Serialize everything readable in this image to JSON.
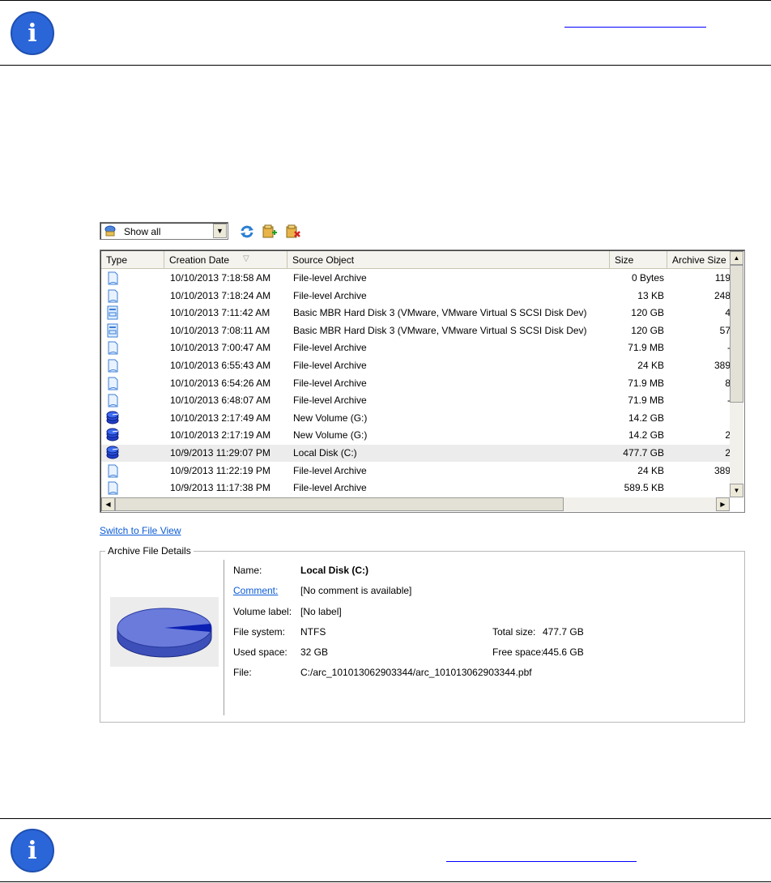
{
  "toolbar": {
    "filter_selected": "Show all",
    "buttons": [
      "refresh-icon",
      "add-archive-icon",
      "delete-archive-icon"
    ]
  },
  "grid": {
    "columns": [
      "Type",
      "Creation Date",
      "Source Object",
      "Size",
      "Archive Size"
    ],
    "rows": [
      {
        "type": "file-archive-icon",
        "date": "10/10/2013 7:18:58 AM",
        "source": "File-level Archive",
        "size": "0 Bytes",
        "archive": "119"
      },
      {
        "type": "file-archive-icon",
        "date": "10/10/2013 7:18:24 AM",
        "source": "File-level Archive",
        "size": "13 KB",
        "archive": "248"
      },
      {
        "type": "disk-archive-icon",
        "date": "10/10/2013 7:11:42 AM",
        "source": "Basic MBR Hard Disk 3 (VMware, VMware Virtual S SCSI Disk Dev)",
        "size": "120 GB",
        "archive": "4"
      },
      {
        "type": "disk-archive-icon",
        "date": "10/10/2013 7:08:11 AM",
        "source": "Basic MBR Hard Disk 3 (VMware, VMware Virtual S SCSI Disk Dev)",
        "size": "120 GB",
        "archive": "57"
      },
      {
        "type": "file-archive-icon",
        "date": "10/10/2013 7:00:47 AM",
        "source": "File-level Archive",
        "size": "71.9 MB",
        "archive": "-"
      },
      {
        "type": "file-archive-icon",
        "date": "10/10/2013 6:55:43 AM",
        "source": "File-level Archive",
        "size": "24 KB",
        "archive": "389"
      },
      {
        "type": "file-archive-icon",
        "date": "10/10/2013 6:54:26 AM",
        "source": "File-level Archive",
        "size": "71.9 MB",
        "archive": "8"
      },
      {
        "type": "file-archive-icon",
        "date": "10/10/2013 6:48:07 AM",
        "source": "File-level Archive",
        "size": "71.9 MB",
        "archive": "-"
      },
      {
        "type": "volume-archive-icon",
        "date": "10/10/2013 2:17:49 AM",
        "source": "New Volume (G:)",
        "size": "14.2 GB",
        "archive": ""
      },
      {
        "type": "volume-archive-icon",
        "date": "10/10/2013 2:17:19 AM",
        "source": "New Volume (G:)",
        "size": "14.2 GB",
        "archive": "2"
      },
      {
        "type": "volume-archive-icon",
        "date": "10/9/2013 11:29:07 PM",
        "source": "Local Disk (C:)",
        "size": "477.7 GB",
        "archive": "2",
        "selected": true
      },
      {
        "type": "file-archive-icon",
        "date": "10/9/2013 11:22:19 PM",
        "source": "File-level Archive",
        "size": "24 KB",
        "archive": "389"
      },
      {
        "type": "file-archive-icon",
        "date": "10/9/2013 11:17:38 PM",
        "source": "File-level Archive",
        "size": "589.5 KB",
        "archive": ""
      }
    ]
  },
  "switch_view_link": "Switch to File View",
  "details": {
    "legend": "Archive File Details",
    "name_label": "Name:",
    "name_value": "Local Disk (C:)",
    "comment_label": "Comment:",
    "comment_value": "[No comment is available]",
    "volume_label_label": "Volume label:",
    "volume_label_value": "[No label]",
    "fs_label": "File system:",
    "fs_value": "NTFS",
    "used_label": "Used space:",
    "used_value": "32 GB",
    "file_label": "File:",
    "file_value": "C:/arc_101013062903344/arc_101013062903344.pbf",
    "total_label": "Total size:",
    "total_value": "477.7 GB",
    "free_label": "Free space:",
    "free_value": "445.6 GB",
    "used_fraction": 0.067
  },
  "colors": {
    "info_icon": "#2b66d9",
    "link": "#0b5bd6",
    "pie_free": "#6a7bdc",
    "pie_used": "#0b1fb3"
  }
}
